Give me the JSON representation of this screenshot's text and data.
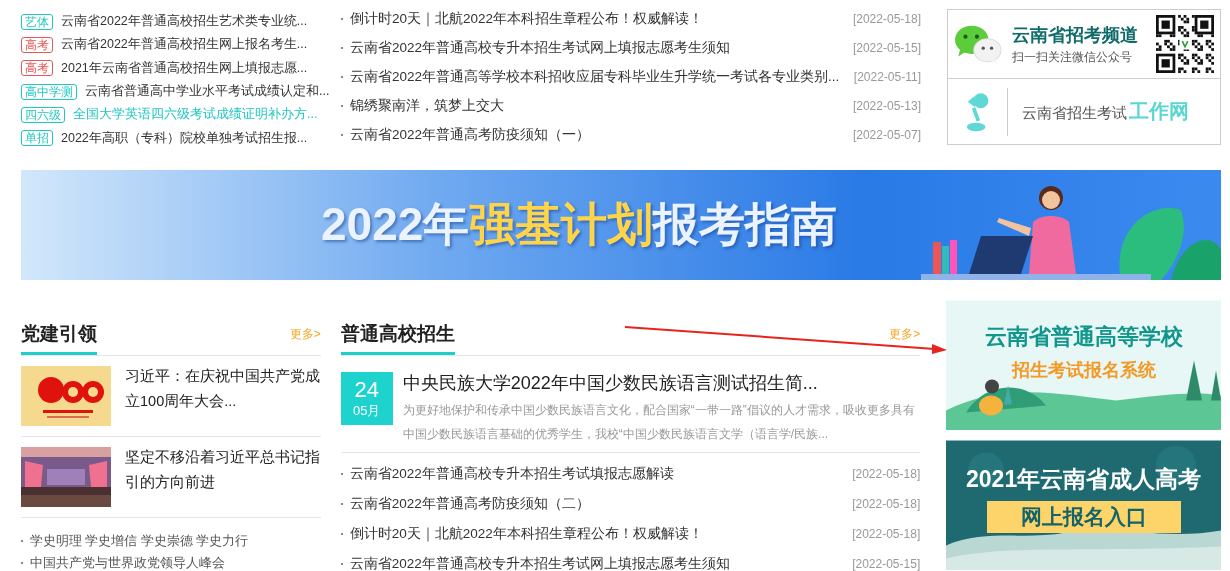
{
  "top_tag_list": [
    {
      "tag": "艺体",
      "color": "#20c9c0",
      "title": "云南省2022年普通高校招生艺术类专业统...",
      "highlighted": false
    },
    {
      "tag": "高考",
      "color": "#e85555",
      "title": "云南省2022年普通高校招生网上报名考生...",
      "highlighted": false
    },
    {
      "tag": "高考",
      "color": "#e85555",
      "title": "2021年云南省普通高校招生网上填报志愿...",
      "highlighted": false
    },
    {
      "tag": "高中学测",
      "color": "#20c9c0",
      "title": "云南省普通高中学业水平考试成绩认定和...",
      "highlighted": false
    },
    {
      "tag": "四六级",
      "color": "#20c9c0",
      "title": "全国大学英语四六级考试成绩证明补办方...",
      "highlighted": true
    },
    {
      "tag": "单招",
      "color": "#20c9c0",
      "title": "2022年高职（专科）院校单独考试招生报...",
      "highlighted": false
    }
  ],
  "top_news": [
    {
      "title": "倒计时20天｜北航2022年本科招生章程公布！权威解读！",
      "date": "[2022-05-18]"
    },
    {
      "title": "云南省2022年普通高校专升本招生考试网上填报志愿考生须知",
      "date": "[2022-05-15]"
    },
    {
      "title": "云南省2022年普通高等学校本科招收应届专科毕业生升学统一考试各专业类别...",
      "date": "[2022-05-11]"
    },
    {
      "title": "锦绣聚南洋，筑梦上交大",
      "date": "[2022-05-13]"
    },
    {
      "title": "云南省2022年普通高考防疫须知（一）",
      "date": "[2022-05-07]"
    }
  ],
  "wechat_card": {
    "title": "云南省招考频道",
    "subtitle": "扫一扫关注微信公众号"
  },
  "work_site_card": {
    "prefix": "云南省招生考试",
    "highlight": "工作网"
  },
  "banner": {
    "parts": [
      {
        "text": "2022年",
        "highlight": false
      },
      {
        "text": "强基计划",
        "highlight": true
      },
      {
        "text": "报考指南",
        "highlight": false
      }
    ]
  },
  "party_section": {
    "title": "党建引领",
    "more": "更多>",
    "features": [
      {
        "title": "习近平：在庆祝中国共产党成立100周年大会..."
      },
      {
        "title": "坚定不移沿着习近平总书记指引的方向前进"
      }
    ],
    "links": [
      "学史明理 学史增信 学史崇德 学史力行",
      "中国共产党与世界政党领导人峰会"
    ]
  },
  "admissions_section": {
    "title": "普通高校招生",
    "more": "更多>",
    "featured": {
      "day": "24",
      "month": "05月",
      "title": "中央民族大学2022年中国少数民族语言测试招生简...",
      "summary": "为更好地保护和传承中国少数民族语言文化，配合国家“一带一路”倡议的人才需求，吸收更多具有中国少数民族语言基础的优秀学生，我校“中国少数民族语言文学（语言学/民族..."
    },
    "news": [
      {
        "title": "云南省2022年普通高校专升本招生考试填报志愿解读",
        "date": "[2022-05-18]"
      },
      {
        "title": "云南省2022年普通高考防疫须知（二）",
        "date": "[2022-05-18]"
      },
      {
        "title": "倒计时20天｜北航2022年本科招生章程公布！权威解读！",
        "date": "[2022-05-18]"
      },
      {
        "title": "云南省2022年普通高校专升本招生考试网上填报志愿考生须知",
        "date": "[2022-05-15]"
      }
    ]
  },
  "side_banners": [
    {
      "kind": "light",
      "line_1": "云南省普通高等学校",
      "line_2": "招生考试报名系统"
    },
    {
      "kind": "dark",
      "line_1": "2021年云南省成人高考",
      "line_2": "网上报名入口"
    }
  ]
}
